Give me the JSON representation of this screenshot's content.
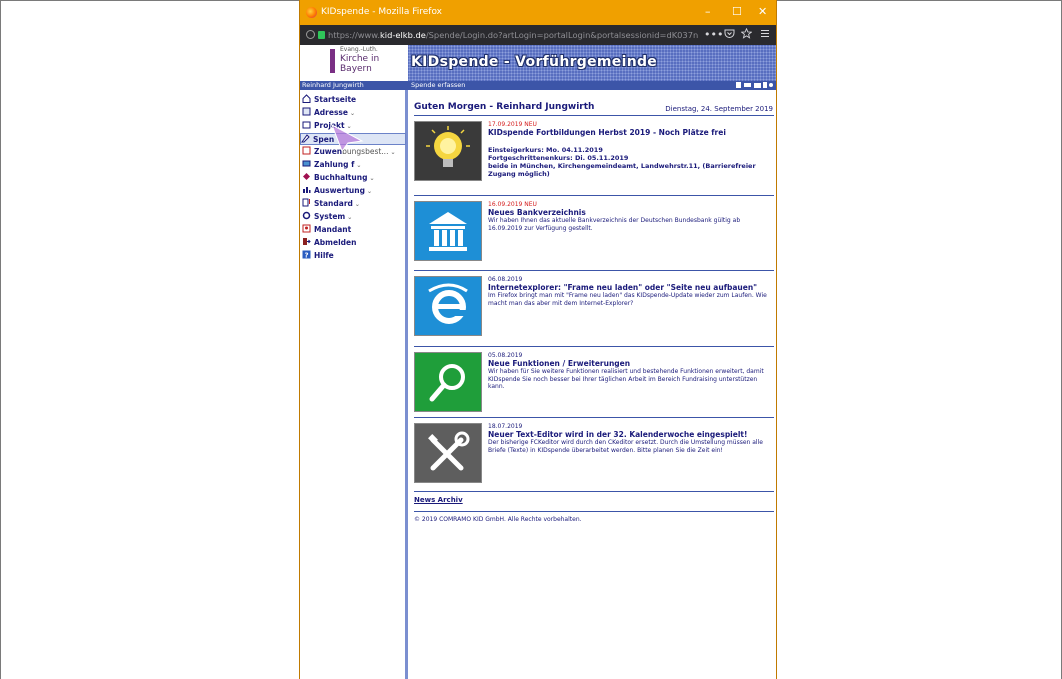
{
  "browser": {
    "window_title": "KIDspende - Mozilla Firefox",
    "url_prefix": "https://www.",
    "url_domain": "kid-elkb.de",
    "url_rest": "/Spende/Login.do?artLogin=portalLogin&portalsessionid=dK037nGvyVR1",
    "more_icon": "•••",
    "minimize": "–",
    "maximize": "☐",
    "close": "✕"
  },
  "banner": {
    "logo_small": "Evang.-Luth.",
    "logo_line1": "Kirche in",
    "logo_line2": "Bayern",
    "heading": "KIDspende - Vorführgemeinde"
  },
  "statusbar": {
    "user": "Reinhard Jungwirth",
    "crumb": "Spende erfassen"
  },
  "sidebar": {
    "items": [
      {
        "label": "Startseite",
        "arrow": ""
      },
      {
        "label": "Adresse",
        "arrow": "⌄"
      },
      {
        "label": "Projekt",
        "arrow": "⌄"
      },
      {
        "label": "Spen",
        "arrow": ""
      },
      {
        "label": "Zuwen",
        "label2": "bungsbest...",
        "arrow": "⌄"
      },
      {
        "label": "Zahlung",
        "label2": "f",
        "arrow": "⌄"
      },
      {
        "label": "Buchhaltung",
        "arrow": "⌄"
      },
      {
        "label": "Auswertung",
        "arrow": "⌄"
      },
      {
        "label": "Standard",
        "arrow": "⌄"
      },
      {
        "label": "System",
        "arrow": "⌄"
      },
      {
        "label": "Mandant",
        "arrow": ""
      },
      {
        "label": "Abmelden",
        "arrow": ""
      },
      {
        "label": "Hilfe",
        "arrow": ""
      }
    ]
  },
  "main": {
    "greeting": "Guten Morgen - Reinhard Jungwirth",
    "date": "Dienstag, 24. September 2019",
    "news": [
      {
        "date": "17.09.2019 NEU",
        "title": "KIDspende Fortbildungen Herbst 2019 - Noch Plätze frei",
        "body": "Einsteigerkurs: Mo. 04.11.2019\nFortgeschrittenenkurs: Di. 05.11.2019\nbeide in München, Kirchengemeindeamt, Landwehrstr.11, (Barrierefreier Zugang möglich)",
        "icon": "lightbulb-icon"
      },
      {
        "date": "16.09.2019 NEU",
        "title": "Neues Bankverzeichnis",
        "body": "Wir haben Ihnen das aktuelle Bankverzeichnis der Deutschen Bundesbank gültig ab 16.09.2019 zur Verfügung gestellt.",
        "icon": "bank-icon"
      },
      {
        "date": "06.08.2019",
        "title": "Internetexplorer: \"Frame neu laden\" oder \"Seite neu aufbauen\"",
        "body": "Im Firefox bringt man mit \"Frame neu laden\" das KIDspende-Update wieder zum Laufen. Wie macht man das aber mit dem Internet-Explorer?",
        "icon": "internet-explorer-icon"
      },
      {
        "date": "05.08.2019",
        "title": "Neue Funktionen / Erweiterungen",
        "body": "Wir haben für Sie weitere Funktionen realisiert und bestehende Funktionen erweitert, damit KIDspende Sie noch besser bei Ihrer täglichen Arbeit im Bereich Fundraising unterstützen kann.",
        "icon": "magnifier-icon"
      },
      {
        "date": "18.07.2019",
        "title": "Neuer Text-Editor wird in der 32. Kalenderwoche eingespielt!",
        "body": "Der bisherige FCKeditor wird durch den CKeditor ersetzt. Durch die Umstellung müssen alle Briefe (Texte) in KIDspende überarbeitet werden. Bitte planen Sie die Zeit ein!",
        "icon": "tools-icon"
      }
    ],
    "archive_link": "News Archiv",
    "copyright": "© 2019 COMRAMO KID GmbH. Alle Rechte vorbehalten."
  },
  "colors": {
    "titlebar": "#f0a000",
    "urlbar": "#2a2a2e",
    "brand_blue": "#3c55a8",
    "text_navy": "#1a1a7a",
    "new_red": "#d41c1c"
  }
}
